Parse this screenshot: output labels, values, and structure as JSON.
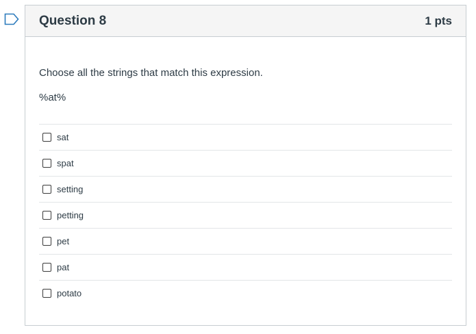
{
  "question": {
    "title": "Question 8",
    "points": "1 pts",
    "text": "Choose all the strings that match this expression.",
    "expression": "%at%",
    "answers": [
      {
        "label": "sat",
        "checked": false
      },
      {
        "label": "spat",
        "checked": false
      },
      {
        "label": "setting",
        "checked": false
      },
      {
        "label": "petting",
        "checked": false
      },
      {
        "label": "pet",
        "checked": false
      },
      {
        "label": "pat",
        "checked": false
      },
      {
        "label": "potato",
        "checked": false
      }
    ]
  },
  "colors": {
    "flag": "#2b7abc",
    "header_bg": "#f5f5f5",
    "border": "#c7cdd1",
    "text": "#2d3b45"
  },
  "icons": {
    "flag": "bookmark-flag-icon"
  }
}
